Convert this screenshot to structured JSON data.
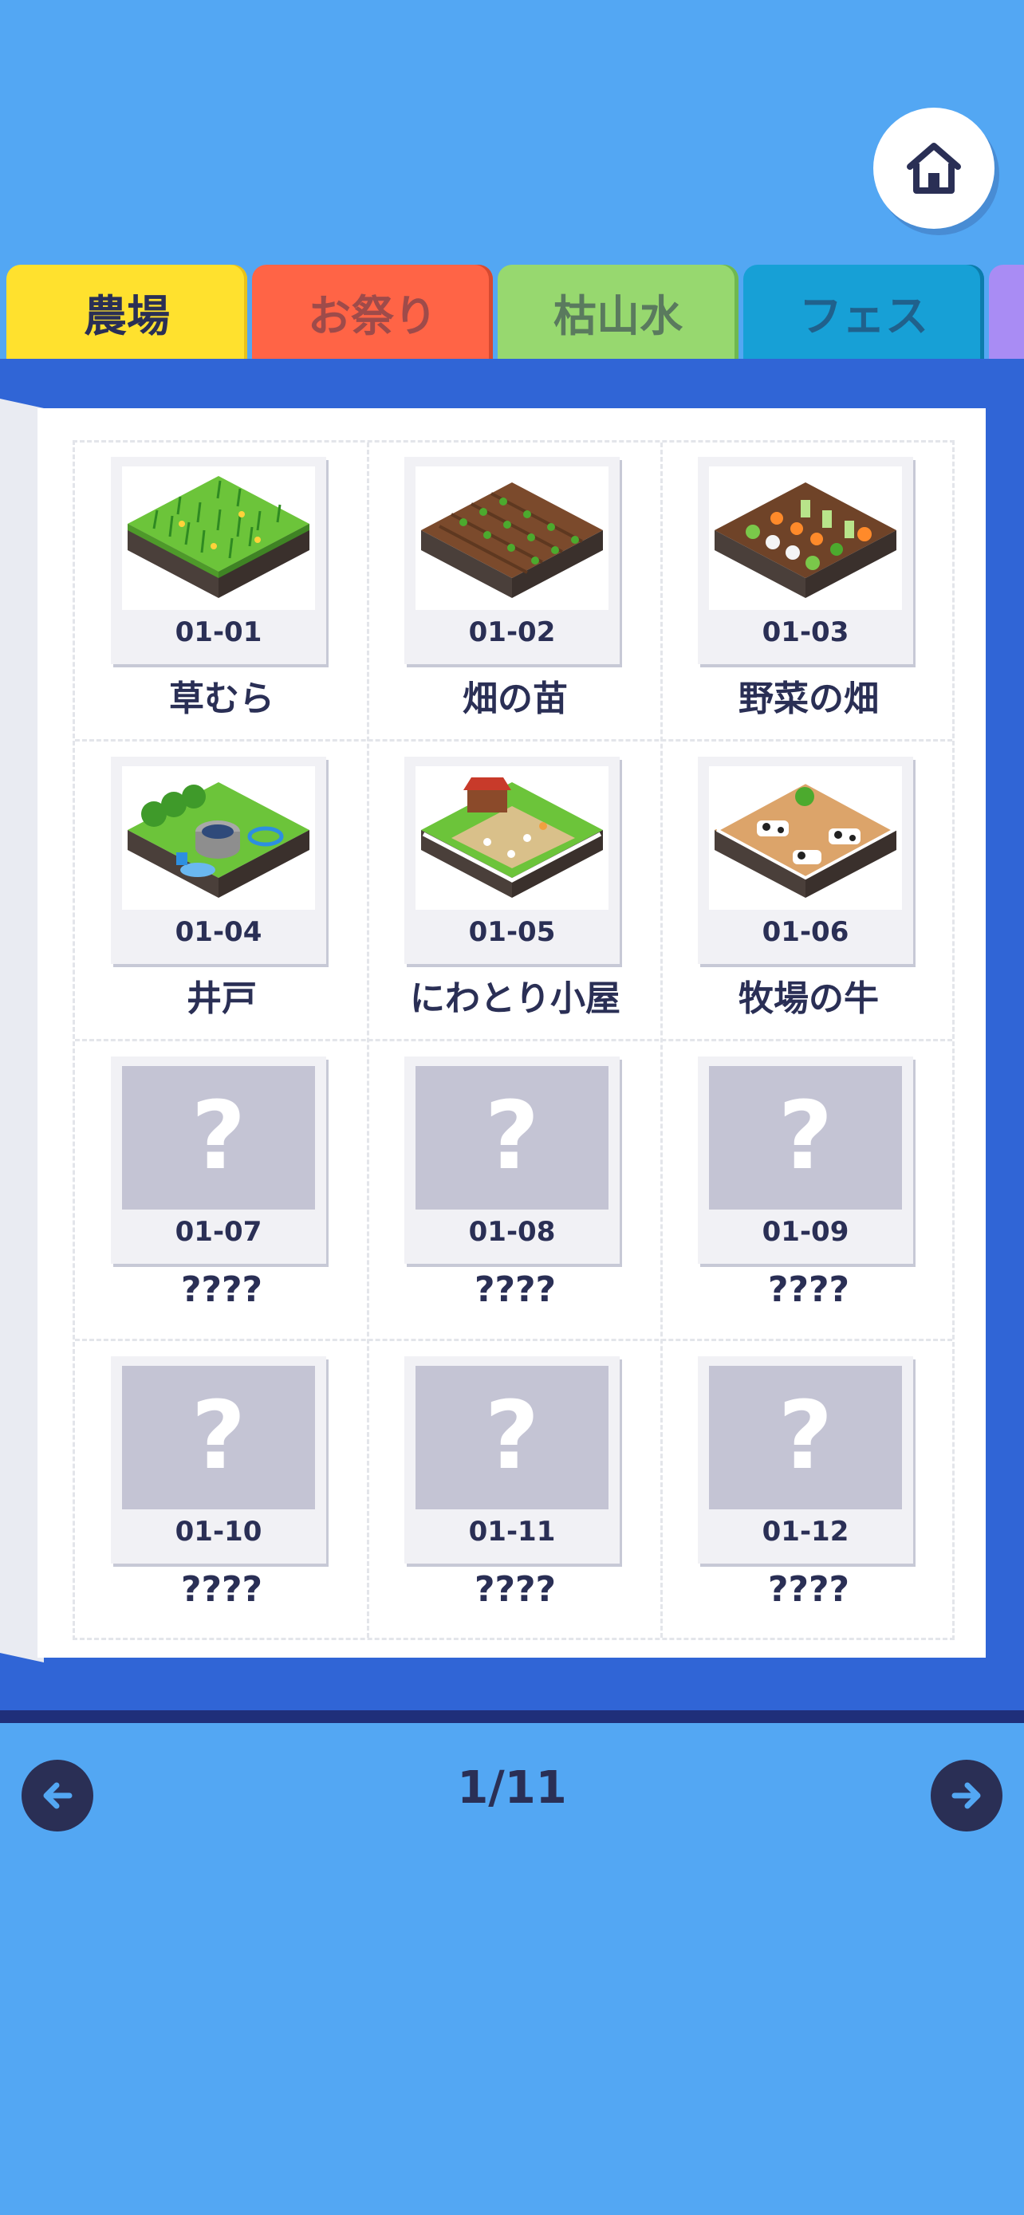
{
  "tabs": [
    {
      "label": "農場",
      "color": "#ffe12e",
      "active": true
    },
    {
      "label": "お祭り",
      "color": "#ff6446",
      "active": false
    },
    {
      "label": "枯山水",
      "color": "#97d86f",
      "active": false
    },
    {
      "label": "フェス",
      "color": "#17a0d6",
      "active": false
    },
    {
      "label": "",
      "color": "#a98cf4",
      "active": false
    }
  ],
  "items": [
    {
      "code": "01-01",
      "name": "草むら",
      "icon": "grass-field-icon",
      "locked": false
    },
    {
      "code": "01-02",
      "name": "畑の苗",
      "icon": "seedling-field-icon",
      "locked": false
    },
    {
      "code": "01-03",
      "name": "野菜の畑",
      "icon": "vegetable-field-icon",
      "locked": false
    },
    {
      "code": "01-04",
      "name": "井戸",
      "icon": "well-icon",
      "locked": false
    },
    {
      "code": "01-05",
      "name": "にわとり小屋",
      "icon": "chicken-coop-icon",
      "locked": false
    },
    {
      "code": "01-06",
      "name": "牧場の牛",
      "icon": "cow-ranch-icon",
      "locked": false
    },
    {
      "code": "01-07",
      "name": "????",
      "icon": "question-icon",
      "locked": true
    },
    {
      "code": "01-08",
      "name": "????",
      "icon": "question-icon",
      "locked": true
    },
    {
      "code": "01-09",
      "name": "????",
      "icon": "question-icon",
      "locked": true
    },
    {
      "code": "01-10",
      "name": "????",
      "icon": "question-icon",
      "locked": true
    },
    {
      "code": "01-11",
      "name": "????",
      "icon": "question-icon",
      "locked": true
    },
    {
      "code": "01-12",
      "name": "????",
      "icon": "question-icon",
      "locked": true
    }
  ],
  "locked_mark": "?",
  "pagination": {
    "text": "1/11",
    "current": 1,
    "total": 11
  },
  "icons": {
    "home": "home-icon",
    "prev": "arrow-left-icon",
    "next": "arrow-right-icon"
  },
  "colors": {
    "background": "#53a7f3",
    "book": "#3065d6",
    "text": "#2a2f55"
  }
}
